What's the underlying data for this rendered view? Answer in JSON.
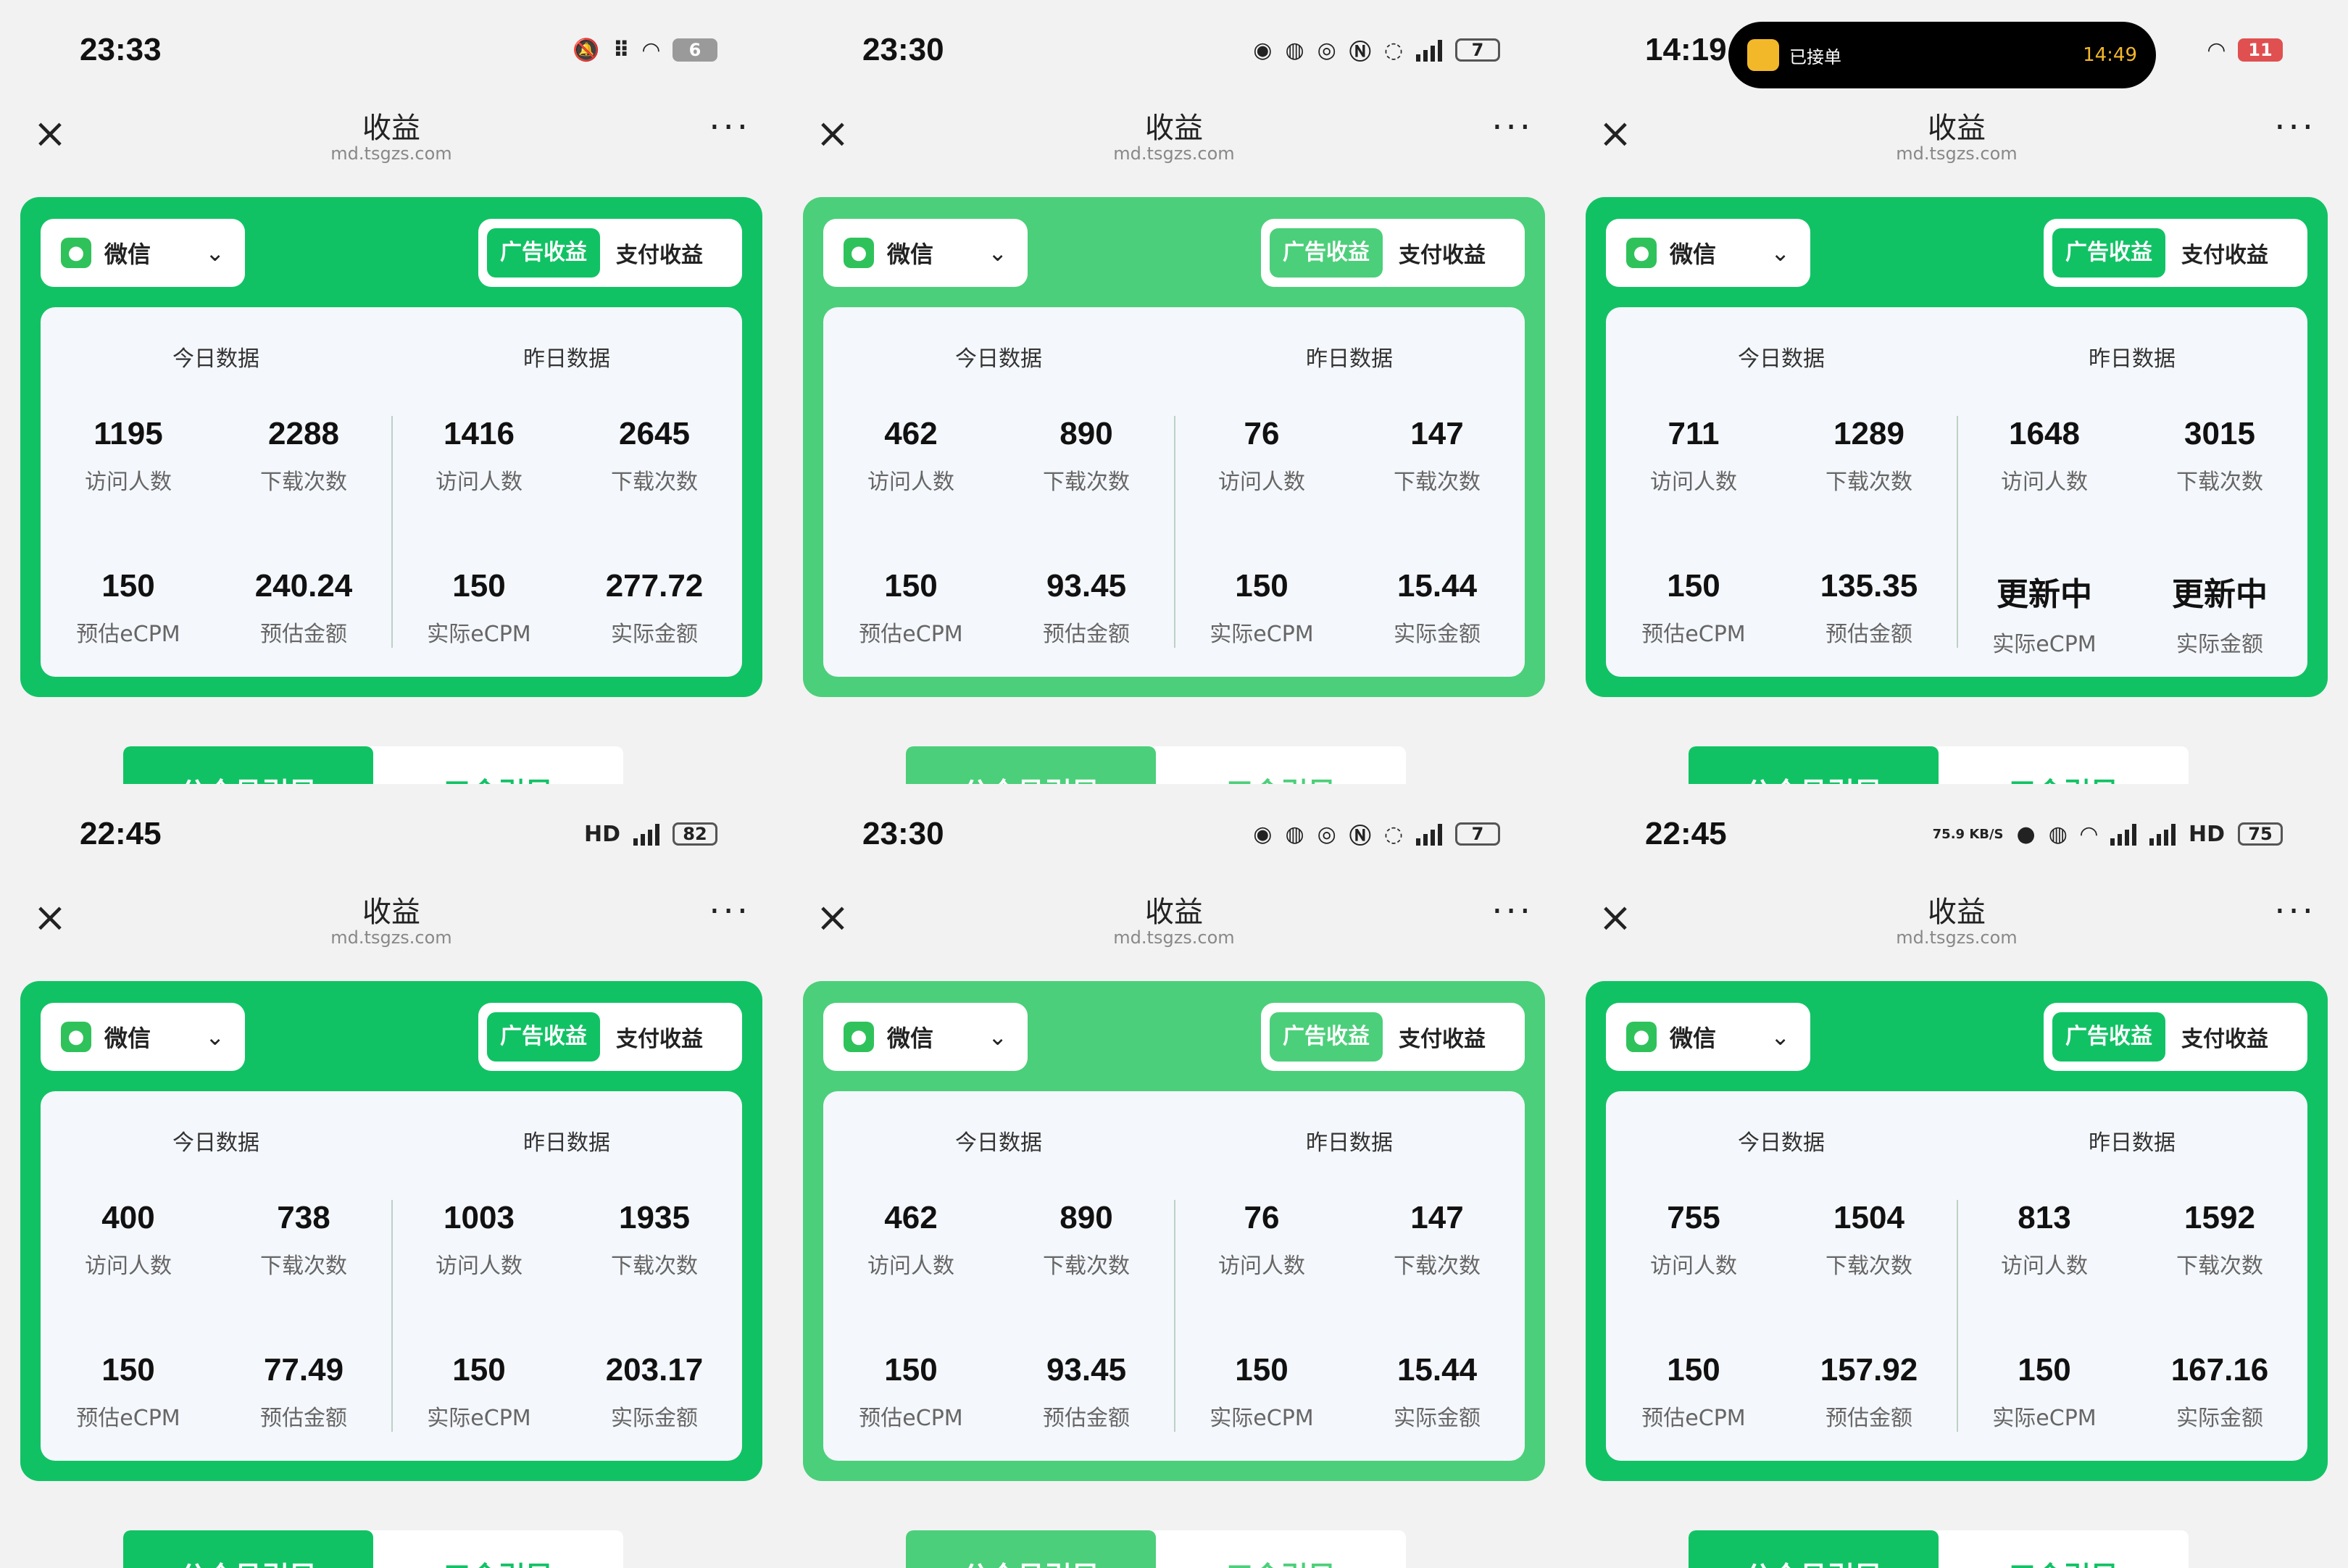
{
  "common": {
    "nav_title": "收益",
    "nav_url": "md.tsgzs.com",
    "close_glyph": "×",
    "more_glyph": "···",
    "platform_label": "微信",
    "chev_glyph": "⌄",
    "tab_ad": "广告收益",
    "tab_pay": "支付收益",
    "today_title": "今日数据",
    "yesterday_title": "昨日数据",
    "guide_gzh": "公众号引导",
    "guide_kl": "口令引导",
    "colors": {
      "green": "#11c264",
      "green_light": "#4ccf7a",
      "bg": "#f2f2f2"
    }
  },
  "panels": [
    {
      "time": "23:33",
      "status_icons": [
        "bell-off-icon",
        "signal-dots-icon",
        "wifi-icon"
      ],
      "battery": "6",
      "light": false,
      "today": [
        {
          "value": "1195",
          "label": "访问人数"
        },
        {
          "value": "2288",
          "label": "下载次数"
        },
        {
          "value": "150",
          "label": "预估eCPM"
        },
        {
          "value": "240.24",
          "label": "预估金额"
        }
      ],
      "yesterday": [
        {
          "value": "1416",
          "label": "访问人数"
        },
        {
          "value": "2645",
          "label": "下载次数"
        },
        {
          "value": "150",
          "label": "实际eCPM"
        },
        {
          "value": "277.72",
          "label": "实际金额"
        }
      ]
    },
    {
      "time": "23:30",
      "status_icons": [
        "weibo-icon",
        "app-icon",
        "eye-icon",
        "nfc-icon",
        "hotspot-icon",
        "signal-icon"
      ],
      "battery": "7",
      "light": true,
      "today": [
        {
          "value": "462",
          "label": "访问人数"
        },
        {
          "value": "890",
          "label": "下载次数"
        },
        {
          "value": "150",
          "label": "预估eCPM"
        },
        {
          "value": "93.45",
          "label": "预估金额"
        }
      ],
      "yesterday": [
        {
          "value": "76",
          "label": "访问人数"
        },
        {
          "value": "147",
          "label": "下载次数"
        },
        {
          "value": "150",
          "label": "实际eCPM"
        },
        {
          "value": "15.44",
          "label": "实际金额"
        }
      ]
    },
    {
      "time": "14:19",
      "island_text": "已接单",
      "island_time": "14:49",
      "status_icons": [
        "wifi-icon"
      ],
      "battery": "11",
      "light": false,
      "today": [
        {
          "value": "711",
          "label": "访问人数"
        },
        {
          "value": "1289",
          "label": "下载次数"
        },
        {
          "value": "150",
          "label": "预估eCPM"
        },
        {
          "value": "135.35",
          "label": "预估金额"
        }
      ],
      "yesterday": [
        {
          "value": "1648",
          "label": "访问人数"
        },
        {
          "value": "3015",
          "label": "下载次数"
        },
        {
          "value": "更新中",
          "label": "实际eCPM"
        },
        {
          "value": "更新中",
          "label": "实际金额"
        }
      ]
    },
    {
      "time": "22:45",
      "status_icons": [
        "hd-icon",
        "signal-icon"
      ],
      "battery": "82",
      "light": false,
      "today": [
        {
          "value": "400",
          "label": "访问人数"
        },
        {
          "value": "738",
          "label": "下载次数"
        },
        {
          "value": "150",
          "label": "预估eCPM"
        },
        {
          "value": "77.49",
          "label": "预估金额"
        }
      ],
      "yesterday": [
        {
          "value": "1003",
          "label": "访问人数"
        },
        {
          "value": "1935",
          "label": "下载次数"
        },
        {
          "value": "150",
          "label": "实际eCPM"
        },
        {
          "value": "203.17",
          "label": "实际金额"
        }
      ]
    },
    {
      "time": "23:30",
      "status_icons": [
        "weibo-icon",
        "app-icon",
        "eye-icon",
        "nfc-icon",
        "hotspot-icon",
        "signal-icon"
      ],
      "battery": "7",
      "light": true,
      "today": [
        {
          "value": "462",
          "label": "访问人数"
        },
        {
          "value": "890",
          "label": "下载次数"
        },
        {
          "value": "150",
          "label": "预估eCPM"
        },
        {
          "value": "93.45",
          "label": "预估金额"
        }
      ],
      "yesterday": [
        {
          "value": "76",
          "label": "访问人数"
        },
        {
          "value": "147",
          "label": "下载次数"
        },
        {
          "value": "150",
          "label": "实际eCPM"
        },
        {
          "value": "15.44",
          "label": "实际金额"
        }
      ]
    },
    {
      "time": "22:45",
      "status_icons": [
        "circle-icon",
        "app-icon",
        "wifi-icon",
        "signal-icon",
        "signal-icon"
      ],
      "speed_text": "75.9 KB/S",
      "hd_text": "HD",
      "battery": "75",
      "light": false,
      "today": [
        {
          "value": "755",
          "label": "访问人数"
        },
        {
          "value": "1504",
          "label": "下载次数"
        },
        {
          "value": "150",
          "label": "预估eCPM"
        },
        {
          "value": "157.92",
          "label": "预估金额"
        }
      ],
      "yesterday": [
        {
          "value": "813",
          "label": "访问人数"
        },
        {
          "value": "1592",
          "label": "下载次数"
        },
        {
          "value": "150",
          "label": "实际eCPM"
        },
        {
          "value": "167.16",
          "label": "实际金额"
        }
      ]
    }
  ]
}
